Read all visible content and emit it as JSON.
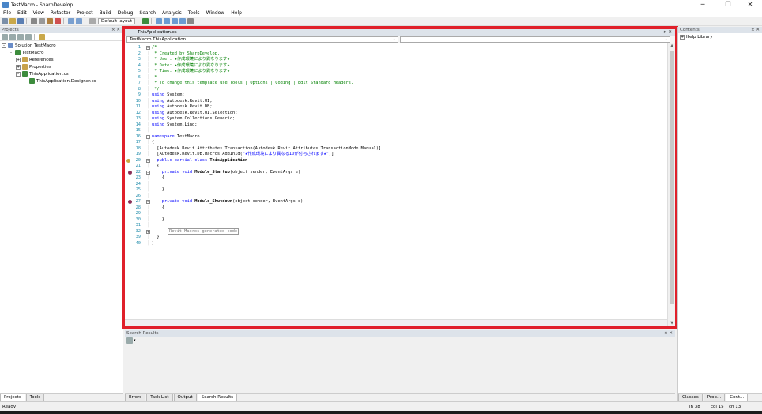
{
  "window": {
    "title": "TestMacro - SharpDevelop",
    "minimize_glyph": "─",
    "restore_glyph": "❐",
    "close_glyph": "✕"
  },
  "menu": [
    "File",
    "Edit",
    "View",
    "Refactor",
    "Project",
    "Build",
    "Debug",
    "Search",
    "Analysis",
    "Tools",
    "Window",
    "Help"
  ],
  "toolbar": {
    "layout_label": "Default layout"
  },
  "projects_pad": {
    "title": "Projects",
    "close_glyph": "× ✕",
    "tree": [
      {
        "label": "Solution TestMacro",
        "indent": 0,
        "expander": "-",
        "icon_color": "#6a8cc8"
      },
      {
        "label": "TestMacro",
        "indent": 1,
        "expander": "-",
        "icon_color": "#3d8c3d"
      },
      {
        "label": "References",
        "indent": 2,
        "expander": "+",
        "icon_color": "#c8a24a"
      },
      {
        "label": "Properties",
        "indent": 2,
        "expander": "+",
        "icon_color": "#c8a24a"
      },
      {
        "label": "ThisApplication.cs",
        "indent": 2,
        "expander": "-",
        "icon_color": "#3d8c3d"
      },
      {
        "label": "ThisApplication.Designer.cs",
        "indent": 3,
        "expander": "",
        "icon_color": "#3d8c3d"
      }
    ],
    "tabs": [
      "Projects",
      "Tools"
    ]
  },
  "editor": {
    "tab_title": "ThisApplication.cs",
    "tab_close": "× ✕",
    "class_combo": "TestMacro.ThisApplication",
    "member_combo": "",
    "combo_chevron": "⌄",
    "lines": [
      {
        "n": "1",
        "text": "/*",
        "cls": "cm"
      },
      {
        "n": "2",
        "text": " * Created by SharpDevelop.",
        "cls": "cm"
      },
      {
        "n": "3",
        "text": " * User: ★作成環境により異なります★",
        "cls": "cm"
      },
      {
        "n": "4",
        "text": " * Date: ★作成環境により異なります★",
        "cls": "cm"
      },
      {
        "n": "5",
        "text": " * Time: ★作成環境により異なります★",
        "cls": "cm"
      },
      {
        "n": "6",
        "text": " *",
        "cls": "cm"
      },
      {
        "n": "7",
        "text": " * To change this template use Tools | Options | Coding | Edit Standard Headers.",
        "cls": "cm"
      },
      {
        "n": "8",
        "text": " */",
        "cls": "cm"
      },
      {
        "n": "9",
        "kw": "using",
        "text": " System;"
      },
      {
        "n": "10",
        "kw": "using",
        "text": " Autodesk.Revit.UI;"
      },
      {
        "n": "11",
        "kw": "using",
        "text": " Autodesk.Revit.DB;"
      },
      {
        "n": "12",
        "kw": "using",
        "text": " Autodesk.Revit.UI.Selection;"
      },
      {
        "n": "13",
        "kw": "using",
        "text": " System.Collections.Generic;"
      },
      {
        "n": "14",
        "kw": "using",
        "text": " System.Linq;"
      },
      {
        "n": "15",
        "text": ""
      },
      {
        "n": "16",
        "kw": "namespace",
        "text": " TestMacro"
      },
      {
        "n": "17",
        "text": "{"
      },
      {
        "n": "18",
        "text": "  [Autodesk.Revit.Attributes.Transaction(Autodesk.Revit.Attributes.TransactionMode.Manual)]"
      },
      {
        "n": "19",
        "pre": "  [Autodesk.Revit.DB.Macros.AddInId(",
        "str": "\"★作成環境により異なるIDが付与されます★\"",
        "post": ")]"
      },
      {
        "n": "20",
        "kw": "  public partial class",
        "bold": " ThisApplication",
        "bp": "bp2"
      },
      {
        "n": "21",
        "text": "  {"
      },
      {
        "n": "22",
        "kw": "    private void",
        "bold": " Module_Startup",
        "rest": "(object sender, EventArgs e)",
        "bp": "bp"
      },
      {
        "n": "23",
        "text": "    {"
      },
      {
        "n": "24",
        "text": ""
      },
      {
        "n": "25",
        "text": "    }"
      },
      {
        "n": "26",
        "text": ""
      },
      {
        "n": "27",
        "kw": "    private void",
        "bold": " Module_Shutdown",
        "rest": "(object sender, EventArgs e)",
        "bp": "bp"
      },
      {
        "n": "28",
        "text": "    {"
      },
      {
        "n": "29",
        "text": ""
      },
      {
        "n": "30",
        "text": "    }"
      },
      {
        "n": "31",
        "text": ""
      },
      {
        "n": "32",
        "boxed": "Revit Macros generated code"
      },
      {
        "n": "39",
        "text": "  }"
      },
      {
        "n": "40",
        "text": "}"
      }
    ]
  },
  "search_pad": {
    "title": "Search Results",
    "close_glyph": "× ✕",
    "tabs": [
      "Errors",
      "Task List",
      "Output",
      "Search Results"
    ]
  },
  "right_pad": {
    "title": "Contents",
    "close_glyph": "× ✕",
    "items": [
      "Help Library"
    ],
    "tabs": [
      "Classes",
      "Prop...",
      "Cont..."
    ]
  },
  "status": {
    "text": "Ready",
    "line": "ln 38",
    "col": "col 15",
    "ch": "ch 13"
  }
}
